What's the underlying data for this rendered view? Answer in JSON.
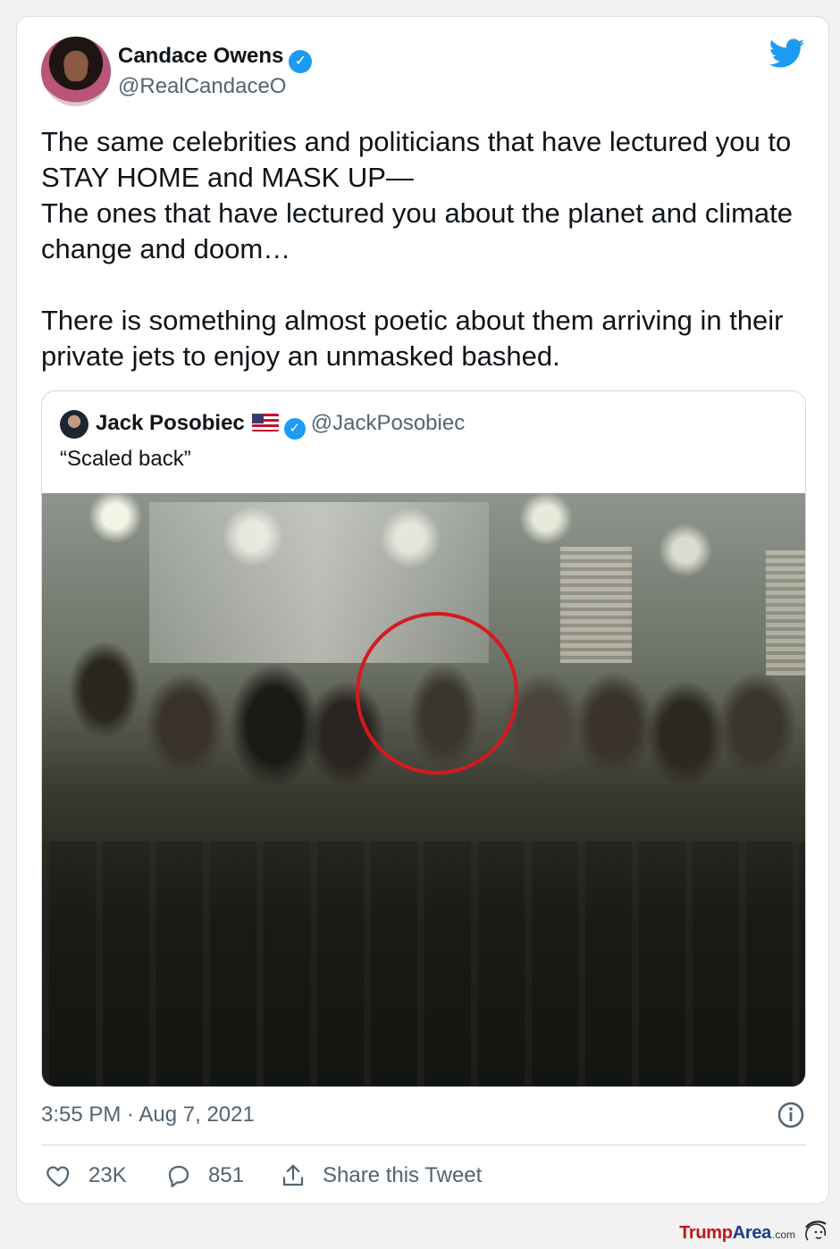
{
  "tweet": {
    "author": {
      "name": "Candace Owens",
      "handle": "@RealCandaceO",
      "verified": true
    },
    "text": "The same celebrities and politicians that have lectured you to STAY HOME and MASK UP—\nThe ones that have lectured you about the planet and climate change and doom…\n\nThere is something almost poetic about them arriving in their private jets to enjoy an unmasked bashed.",
    "timestamp": "3:55 PM · Aug 7, 2021",
    "quoted": {
      "name": "Jack Posobiec",
      "flag": "🇺🇸",
      "verified": true,
      "handle": "@JackPosobiec",
      "text": "“Scaled back”",
      "media": {
        "description_icon": "photo",
        "highlight_color": "#d41a1f"
      }
    },
    "actions": {
      "likes": "23K",
      "replies": "851",
      "share_label": "Share this Tweet"
    }
  },
  "icons": {
    "brand": "twitter-bird-icon",
    "verified": "verified-badge-icon",
    "info": "info-icon",
    "like": "heart-icon",
    "reply": "speech-bubble-icon",
    "share": "share-upload-icon"
  },
  "colors": {
    "twitter_blue": "#1d9bf0",
    "text": "#0f1419",
    "secondary": "#536471",
    "border": "#cfd9de"
  },
  "watermark": {
    "part1": "Trump",
    "part2": "Area",
    "suffix": ".com"
  }
}
